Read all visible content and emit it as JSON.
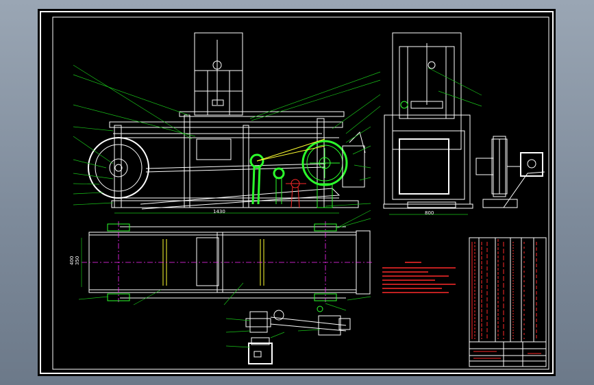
{
  "dimensions": {
    "front_length": "1430",
    "side_width": "800",
    "plan_width_a": "400",
    "plan_width_b": "350"
  },
  "colors": {
    "background": "#000000",
    "outline": "#ffffff",
    "leader": "#2cff2c",
    "notes": "#ff2a2a",
    "centerline": "#ff2aff",
    "surround": "#8796a6"
  },
  "icons": [
    "belt-pulley-icon",
    "gear-motor-icon",
    "eccentric-crank-icon"
  ]
}
